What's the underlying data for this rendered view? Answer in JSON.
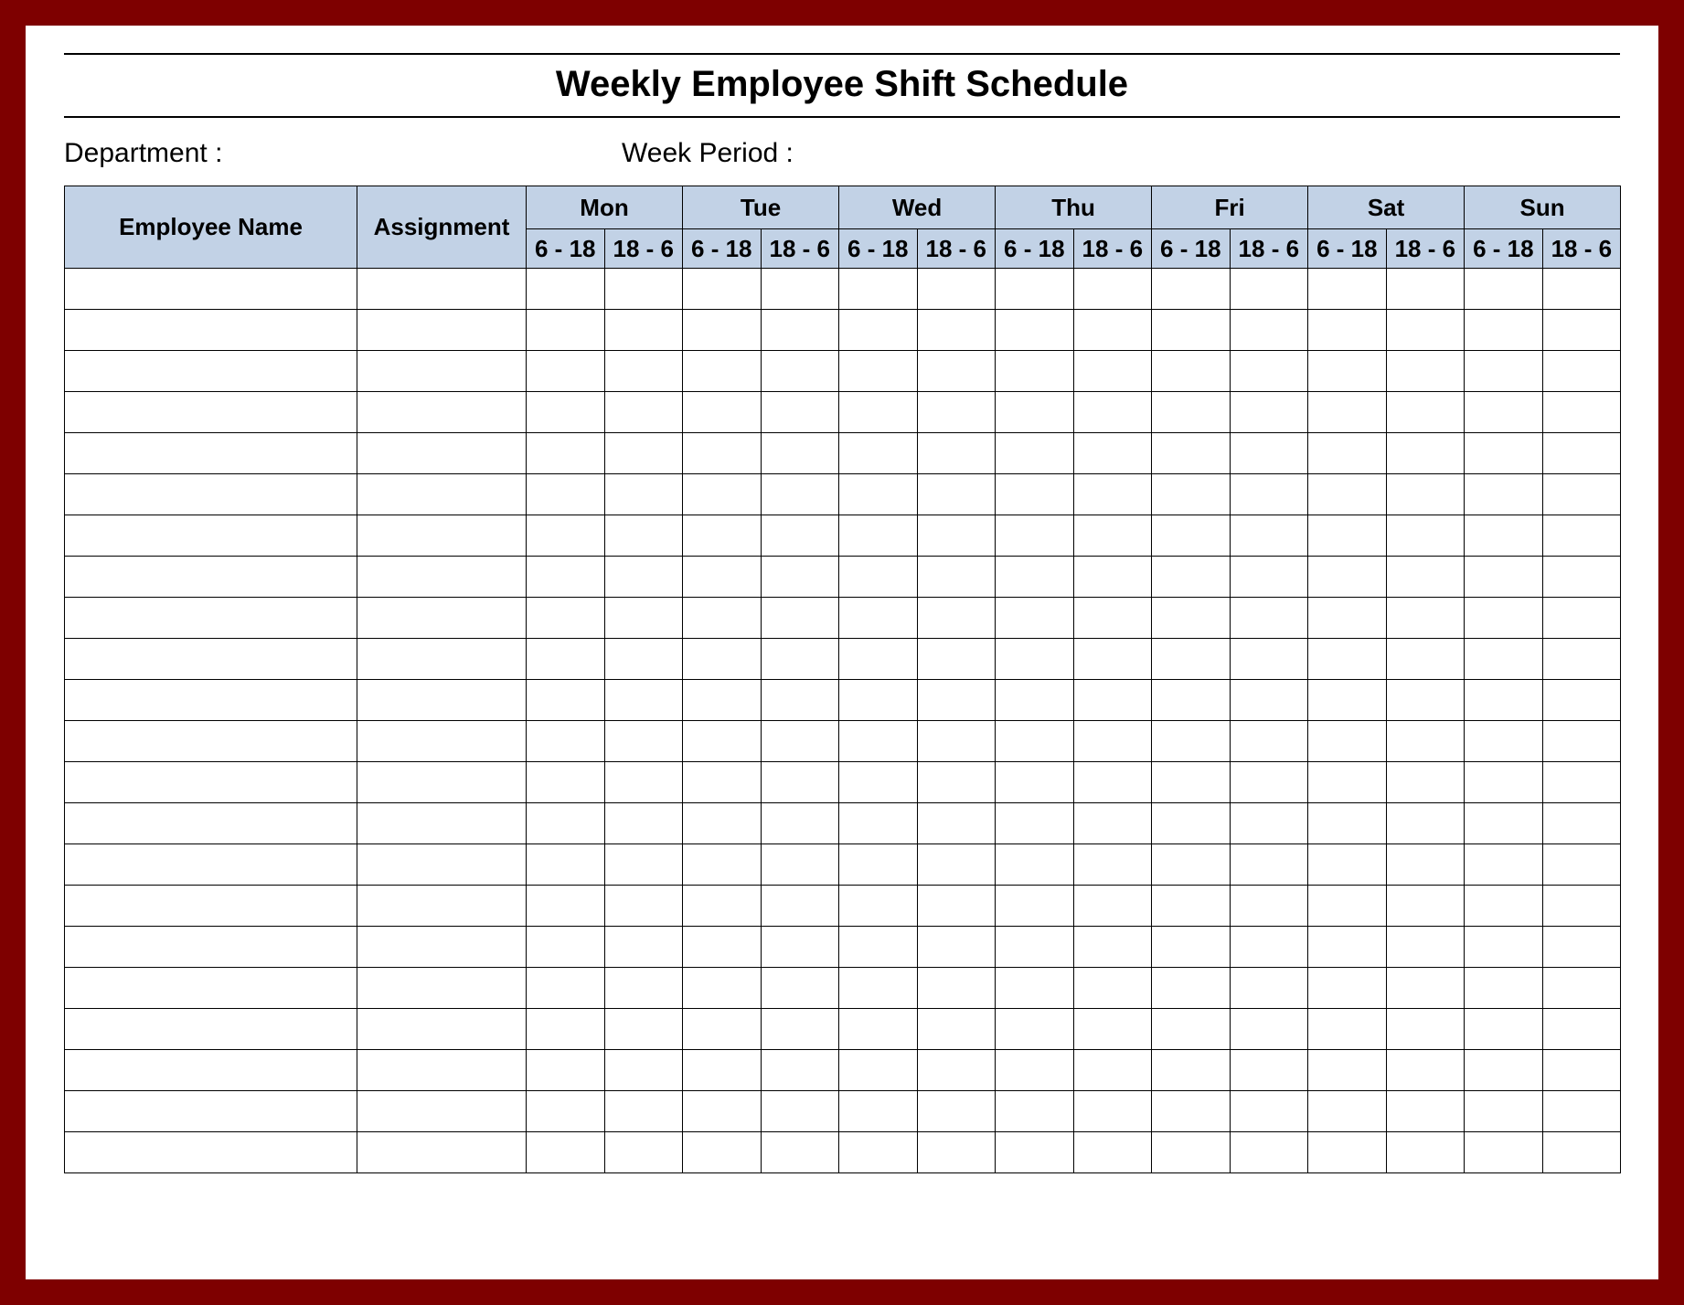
{
  "title": "Weekly Employee Shift Schedule",
  "labels": {
    "department": "Department :",
    "week_period": "Week  Period :"
  },
  "columns": {
    "employee_name": "Employee Name",
    "assignment": "Assignment"
  },
  "days": [
    "Mon",
    "Tue",
    "Wed",
    "Thu",
    "Fri",
    "Sat",
    "Sun"
  ],
  "shifts": [
    "6 - 18",
    "18 - 6"
  ],
  "row_count": 22
}
